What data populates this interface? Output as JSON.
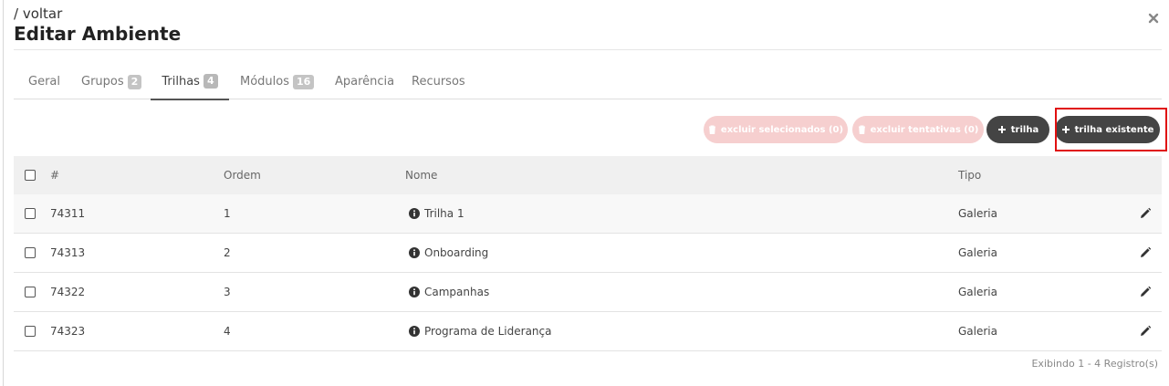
{
  "header": {
    "back_label": "/ voltar",
    "title": "Editar Ambiente"
  },
  "tabs": [
    {
      "label": "Geral",
      "badge": null
    },
    {
      "label": "Grupos",
      "badge": "2"
    },
    {
      "label": "Trilhas",
      "badge": "4",
      "active": true
    },
    {
      "label": "Módulos",
      "badge": "16"
    },
    {
      "label": "Aparência",
      "badge": null
    },
    {
      "label": "Recursos",
      "badge": null
    }
  ],
  "toolbar": {
    "delete_selected_label": "excluir selecionados (0)",
    "delete_attempts_label": "excluir tentativas (0)",
    "add_trail_label": "trilha",
    "add_existing_trail_label": "trilha existente"
  },
  "table": {
    "columns": [
      "#",
      "Ordem",
      "Nome",
      "Tipo"
    ],
    "rows": [
      {
        "id": "74311",
        "order": "1",
        "name": "Trilha 1",
        "type": "Galeria"
      },
      {
        "id": "74313",
        "order": "2",
        "name": "Onboarding",
        "type": "Galeria"
      },
      {
        "id": "74322",
        "order": "3",
        "name": "Campanhas",
        "type": "Galeria"
      },
      {
        "id": "74323",
        "order": "4",
        "name": "Programa de Liderança",
        "type": "Galeria"
      }
    ]
  },
  "footer": {
    "pagination_text": "Exibindo 1 - 4 Registro(s)"
  },
  "colors": {
    "danger_disabled": "#f6cfcf",
    "dark_button": "#444444",
    "highlight": "#e01010"
  }
}
